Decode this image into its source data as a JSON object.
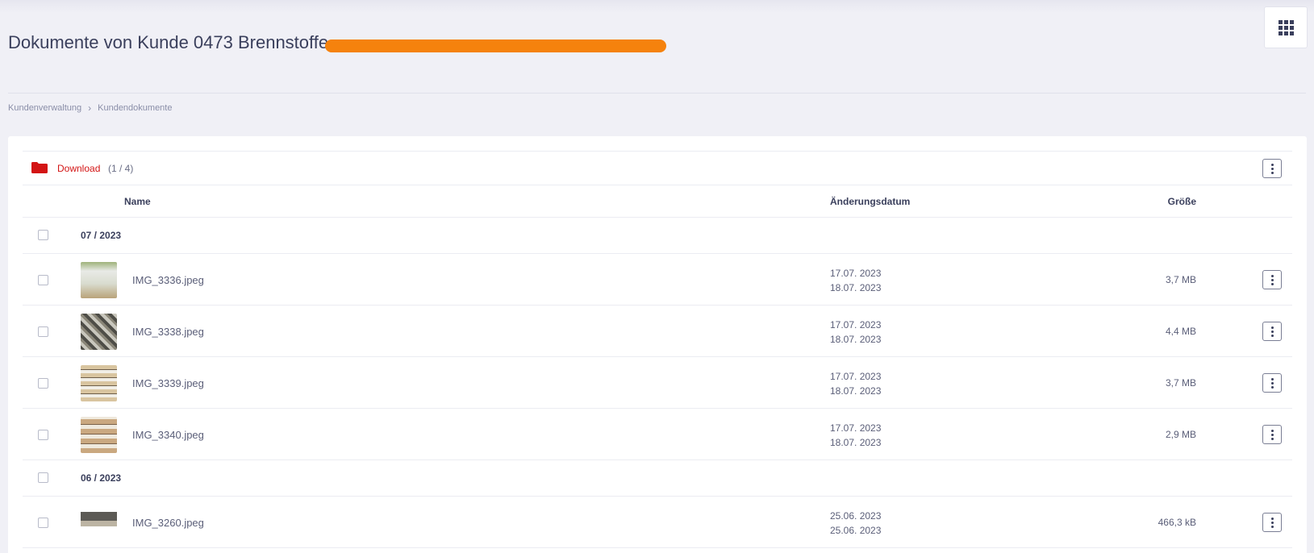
{
  "page": {
    "title": "Dokumente von Kunde 0473 Brennstoffe"
  },
  "breadcrumb": {
    "items": [
      {
        "label": "Kundenverwaltung"
      },
      {
        "label": "Kundendokumente"
      }
    ]
  },
  "folder": {
    "name": "Download",
    "count": "(1 / 4)"
  },
  "table": {
    "columns": {
      "name": "Name",
      "date": "Änderungsdatum",
      "size": "Größe"
    },
    "groups": [
      {
        "label": "07 / 2023",
        "files": [
          {
            "name": "IMG_3336.jpeg",
            "created": "17.07. 2023",
            "modified": "18.07. 2023",
            "size": "3,7 MB"
          },
          {
            "name": "IMG_3338.jpeg",
            "created": "17.07. 2023",
            "modified": "18.07. 2023",
            "size": "4,4 MB"
          },
          {
            "name": "IMG_3339.jpeg",
            "created": "17.07. 2023",
            "modified": "18.07. 2023",
            "size": "3,7 MB"
          },
          {
            "name": "IMG_3340.jpeg",
            "created": "17.07. 2023",
            "modified": "18.07. 2023",
            "size": "2,9 MB"
          }
        ]
      },
      {
        "label": "06 / 2023",
        "files": [
          {
            "name": "IMG_3260.jpeg",
            "created": "25.06. 2023",
            "modified": "25.06. 2023",
            "size": "466,3 kB"
          }
        ]
      }
    ]
  },
  "icons": {
    "apps": "apps-grid-icon",
    "folder": "folder-icon",
    "more": "more-vertical-icon"
  },
  "colors": {
    "accent": "#d31414",
    "redaction": "#f5820d",
    "background": "#f0f0f6"
  }
}
